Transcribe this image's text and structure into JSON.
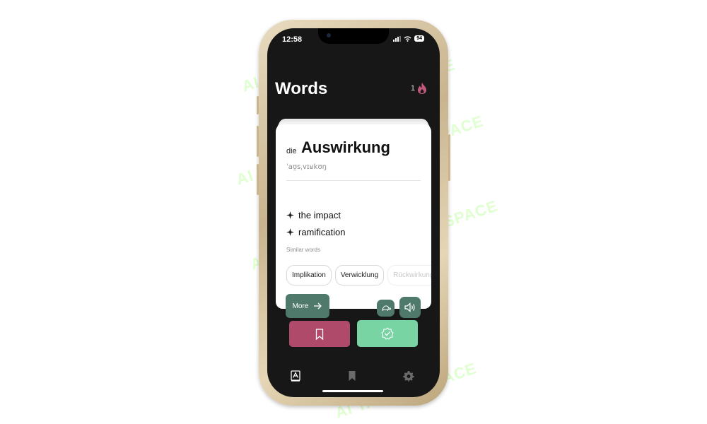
{
  "watermark": {
    "text": "AI TALENT SPACE"
  },
  "status_bar": {
    "time": "12:58",
    "battery": "94"
  },
  "header": {
    "title": "Words",
    "streak_count": "1",
    "streak_icon": "flame-icon"
  },
  "card": {
    "article": "die",
    "word": "Auswirkung",
    "ipa": "ˈaʊ̯sˌvɪʁkʊŋ",
    "translations": [
      "the impact",
      "ramification"
    ],
    "similar_label": "Similar words",
    "similar_words": [
      "Implikation",
      "Verwicklung",
      "Rückwirkung"
    ],
    "more_label": "More"
  },
  "actions": {
    "save_icon": "bookmark-icon",
    "known_icon": "check-badge-icon"
  },
  "tabs": [
    {
      "name": "words",
      "icon": "dictionary-icon",
      "active": true
    },
    {
      "name": "saved",
      "icon": "bookmark-icon",
      "active": false
    },
    {
      "name": "settings",
      "icon": "gear-icon",
      "active": false
    }
  ],
  "colors": {
    "accent_green": "#4f7a6b",
    "save_pink": "#b04a6a",
    "known_green": "#78d4a2",
    "background": "#171717",
    "watermark": "#a8ff7a"
  }
}
